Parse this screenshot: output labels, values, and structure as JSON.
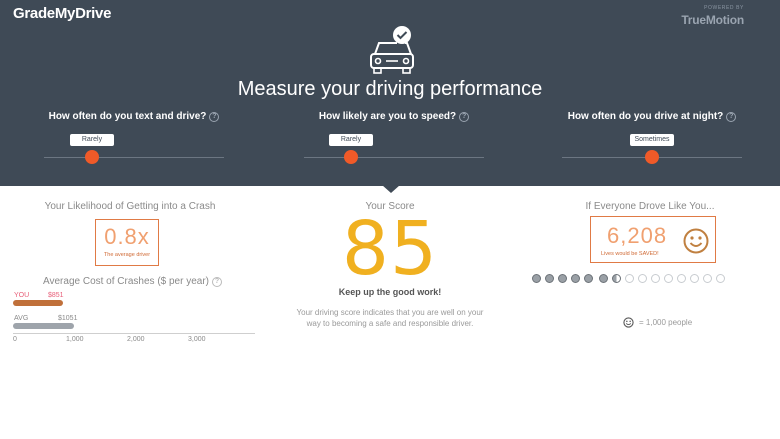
{
  "header": {
    "logo_text": "GradeMyDrive",
    "powered_by": "POWERED BY",
    "partner_brand": "TrueMotion",
    "title": "Measure your driving performance"
  },
  "questions": [
    {
      "label": "How often do you text and drive?",
      "help": "?",
      "value": "Rarely"
    },
    {
      "label": "How likely are you to speed?",
      "help": "?",
      "value": "Rarely"
    },
    {
      "label": "How often do you drive at night?",
      "help": "?",
      "value": "Sometimes"
    }
  ],
  "likelihood": {
    "title": "Your Likelihood of Getting into a Crash",
    "value": "0.8x",
    "caption": "The average driver"
  },
  "cost": {
    "title": "Average Cost of Crashes ($ per year)",
    "help": "?",
    "you_label": "YOU",
    "you_value": "$851",
    "you_amount": 851,
    "avg_label": "AVG",
    "avg_value": "$1051",
    "avg_amount": 1051,
    "axis_ticks": [
      "0",
      "1,000",
      "2,000",
      "3,000"
    ],
    "axis_max": 3500
  },
  "score": {
    "title": "Your Score",
    "value": "85",
    "headline": "Keep up the good work!",
    "description": "Your driving score indicates that you are well on your way to becoming a safe and responsible driver."
  },
  "impact": {
    "title": "If Everyone Drove Like You...",
    "value": "6,208",
    "caption": "Lives would be SAVED!",
    "filled_people": 6.2,
    "total_people": 15,
    "legend": "= 1,000 people"
  },
  "colors": {
    "header_bg": "#3f4a56",
    "accent_orange": "#f05a28",
    "score_yellow": "#f0b020",
    "you_bar": "#c0703a",
    "avg_bar": "#9ea4ab"
  },
  "icons": [
    "car-check-icon",
    "help-icon",
    "smiley-icon",
    "person-dot-icon"
  ]
}
